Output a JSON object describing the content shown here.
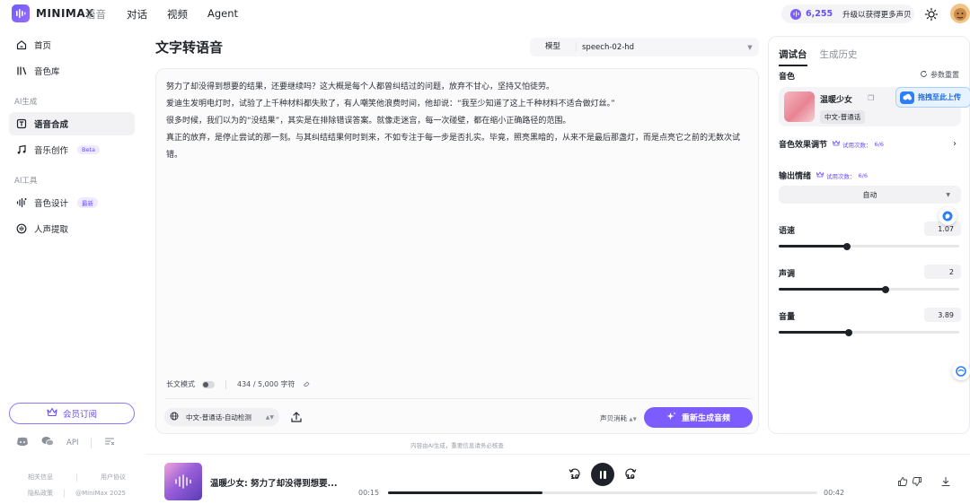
{
  "topbar": {
    "brand": "MINIMAX",
    "brand_sub": "语音",
    "nav": [
      "对话",
      "视频",
      "Agent"
    ],
    "credits": "6,255",
    "upgrade": "升级以获得更多声贝"
  },
  "sidebar": {
    "items": [
      {
        "label": "首页",
        "icon": "home-icon"
      },
      {
        "label": "音色库",
        "icon": "library-icon"
      }
    ],
    "section_gen": "AI生成",
    "gen_items": [
      {
        "label": "语音合成",
        "icon": "tts-icon"
      },
      {
        "label": "音乐创作",
        "icon": "music-icon",
        "badge": "Beta"
      }
    ],
    "section_tools": "AI工具",
    "tool_items": [
      {
        "label": "音色设计",
        "icon": "voice-design-icon",
        "badge": "最新"
      },
      {
        "label": "人声提取",
        "icon": "vocal-extract-icon"
      }
    ],
    "member_button": "会员订阅",
    "social": {
      "api": "API"
    },
    "footer": {
      "about": "相关信息",
      "terms": "用户协议",
      "privacy": "隐私政策",
      "copyright": "@MiniMax 2025"
    }
  },
  "main": {
    "title": "文字转语音",
    "model_label": "模型",
    "model_value": "speech-02-hd",
    "paragraphs": [
      "努力了却没得到想要的结果，还要继续吗？这大概是每个人都曾纠结过的问题，放弃不甘心，坚持又怕徒劳。",
      "爱迪生发明电灯时，试验了上千种材料都失败了，有人嘲笑他浪费时间，他却说：“我至少知道了这上千种材料不适合做灯丝。”",
      "很多时候，我们以为的“没结果”，其实是在排除错误答案。就像走迷宫，每一次碰壁，都在缩小正确路径的范围。",
      "真正的放弃，是停止尝试的那一刻。与其纠结结果何时到来，不如专注于每一步是否扎实。毕竟，照亮黑暗的，从来不是最后那盏灯，而是点亮它之前的无数次试错。"
    ],
    "long_text_mode": "长文模式",
    "char_count": "434 / 5,000 字符",
    "language": "中文-普通话-自动检测",
    "cost_label": "声贝消耗",
    "regen_button": "重新生成音频",
    "disclaimer": "内容由AI生成，重要信息请务必核查"
  },
  "panel": {
    "tabs": [
      "调试台",
      "生成历史"
    ],
    "voice_label": "音色",
    "reset": "参数重置",
    "voice_name": "温暖少女",
    "voice_tag": "中文-普通话",
    "drag_upload": "拖拽至此上传",
    "effect_label": "音色效果调节",
    "trial_text": "试用次数：",
    "trial_count": "6/6",
    "emotion_label": "输出情绪",
    "emotion_value": "自动",
    "speed_label": "语速",
    "speed_value": "1.07",
    "speed_fraction": 0.38,
    "pitch_label": "声调",
    "pitch_value": "2",
    "pitch_fraction": 0.59,
    "volume_label": "音量",
    "volume_value": "3.89",
    "volume_fraction": 0.39
  },
  "player": {
    "title": "温暖少女: 努力了却没得到想要...",
    "current": "00:15",
    "total": "00:42",
    "progress_fraction": 0.36,
    "skip_back": "10",
    "skip_forward": "10"
  }
}
